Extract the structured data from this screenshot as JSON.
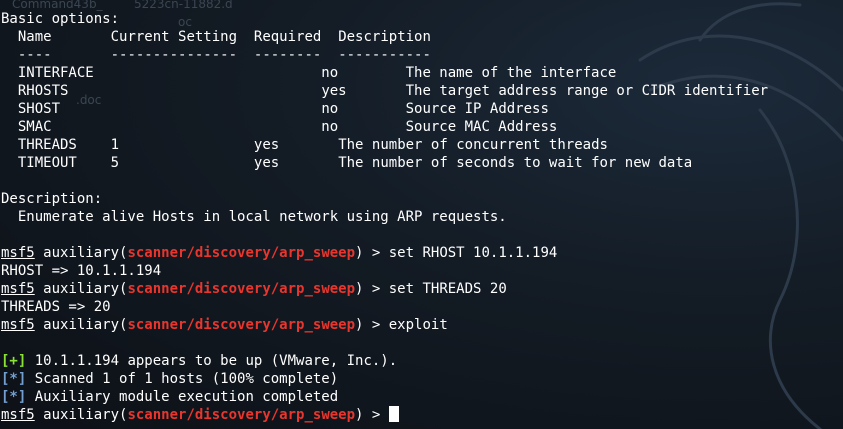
{
  "desktop": {
    "ghost_texts": [
      "Command43b_",
      "5223cn-11882.d",
      "oc",
      ".doc"
    ]
  },
  "colors": {
    "module": "#e8362e",
    "success": "#8ae234",
    "info": "#729fcf",
    "text": "#ffffff"
  },
  "options": {
    "heading": "Basic options:",
    "columns": [
      "Name",
      "Current Setting",
      "Required",
      "Description"
    ],
    "underlines": [
      "----",
      "---------------",
      "--------",
      "-----------"
    ],
    "rows": [
      {
        "name": "INTERFACE",
        "setting": "",
        "required": "no",
        "description": "The name of the interface"
      },
      {
        "name": "RHOSTS",
        "setting": "",
        "required": "yes",
        "description": "The target address range or CIDR identifier"
      },
      {
        "name": "SHOST",
        "setting": "",
        "required": "no",
        "description": "Source IP Address"
      },
      {
        "name": "SMAC",
        "setting": "",
        "required": "no",
        "description": "Source MAC Address"
      },
      {
        "name": "THREADS",
        "setting": "1",
        "required": "yes",
        "description": "The number of concurrent threads"
      },
      {
        "name": "TIMEOUT",
        "setting": "5",
        "required": "yes",
        "description": "The number of seconds to wait for new data"
      }
    ]
  },
  "description": {
    "heading": "Description:",
    "text": "Enumerate alive Hosts in local network using ARP requests."
  },
  "prompt": {
    "name": "msf5",
    "context_prefix": "auxiliary(",
    "module": "scanner/discovery/arp_sweep",
    "context_suffix": ") > "
  },
  "commands": [
    {
      "input": "set RHOST 10.1.1.194",
      "output": "RHOST => 10.1.1.194"
    },
    {
      "input": "set THREADS 20",
      "output": "THREADS => 20"
    },
    {
      "input": "exploit",
      "output": ""
    }
  ],
  "results": [
    {
      "tag": "[+]",
      "kind": "success",
      "text": " 10.1.1.194 appears to be up (VMware, Inc.)."
    },
    {
      "tag": "[*]",
      "kind": "info",
      "text": " Scanned 1 of 1 hosts (100% complete)"
    },
    {
      "tag": "[*]",
      "kind": "info",
      "text": " Auxiliary module execution completed"
    }
  ],
  "final_input": ""
}
